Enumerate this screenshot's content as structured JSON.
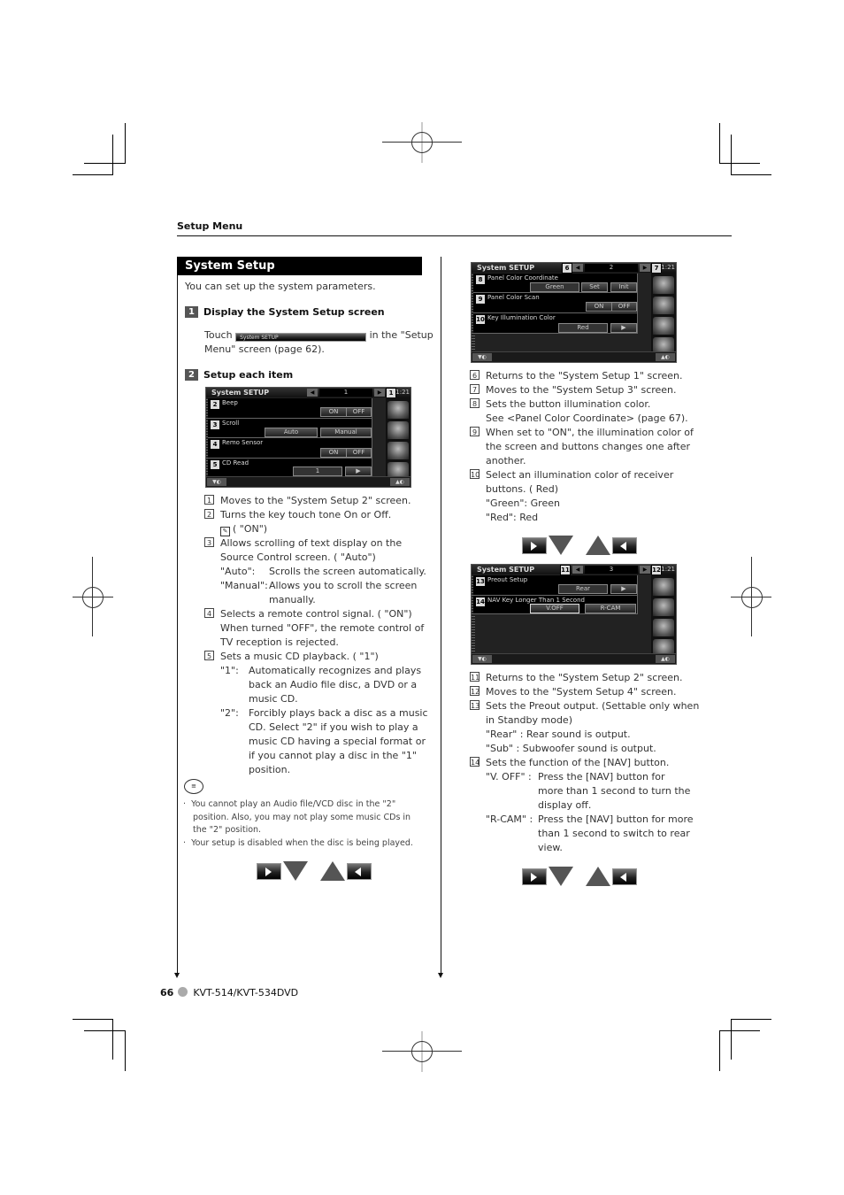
{
  "header": {
    "section": "Setup Menu"
  },
  "title": "System Setup",
  "intro": "You can set up the system parameters.",
  "steps": [
    {
      "num": "1",
      "title": "Display the System Setup screen",
      "text_before": "Touch",
      "button_label": "System SETUP",
      "text_after": "in the \"Setup",
      "text_line2": "Menu\" screen (page 62)."
    },
    {
      "num": "2",
      "title": "Setup each item"
    }
  ],
  "screens": [
    {
      "title": "System SETUP",
      "page": "1",
      "time": "1:21",
      "callouts": {
        "next": "1"
      },
      "rows": [
        {
          "num": "2",
          "label": "Beep",
          "buttons": [
            "ON",
            "OFF"
          ]
        },
        {
          "num": "3",
          "label": "Scroll",
          "buttons": [
            "Auto",
            "Manual"
          ]
        },
        {
          "num": "4",
          "label": "Remo Sensor",
          "buttons": [
            "ON",
            "OFF"
          ]
        },
        {
          "num": "5",
          "label": "CD Read",
          "value": "1",
          "arrow": "▶"
        }
      ]
    },
    {
      "title": "System SETUP",
      "page": "2",
      "time": "1:21",
      "callouts": {
        "prev": "6",
        "next": "7"
      },
      "rows": [
        {
          "num": "8",
          "label": "Panel Color Coordinate",
          "value": "Green",
          "buttons": [
            "Set",
            "Init"
          ]
        },
        {
          "num": "9",
          "label": "Panel Color Scan",
          "buttons": [
            "ON",
            "OFF"
          ]
        },
        {
          "num": "10",
          "label": "Key Illumination Color",
          "value": "Red",
          "arrow": "▶"
        }
      ]
    },
    {
      "title": "System SETUP",
      "page": "3",
      "time": "1:21",
      "callouts": {
        "prev": "11",
        "next": "12"
      },
      "rows": [
        {
          "num": "13",
          "label": "Preout Setup",
          "value": "Rear",
          "arrow": "▶"
        },
        {
          "num": "14",
          "label": "NAV Key Longer Than 1 Second",
          "buttons": [
            "V.OFF",
            "R-CAM"
          ]
        }
      ]
    }
  ],
  "left_list": [
    {
      "num": "1",
      "lines": [
        "Moves to the \"System Setup 2\" screen."
      ]
    },
    {
      "num": "2",
      "lines": [
        "Turns the key touch tone On or Off.",
        "( \"ON\")"
      ]
    },
    {
      "num": "3",
      "lines": [
        "Allows scrolling of text display on the",
        "Source Control screen. ( \"Auto\")"
      ],
      "defs": [
        {
          "term": "\"Auto\":",
          "lines": [
            "Scrolls the screen automatically."
          ]
        },
        {
          "term": "\"Manual\":",
          "lines": [
            "Allows you to scroll the screen",
            "manually."
          ]
        }
      ]
    },
    {
      "num": "4",
      "lines": [
        "Selects a remote control signal. ( \"ON\")",
        "When turned \"OFF\", the remote control of",
        "TV reception is rejected."
      ]
    },
    {
      "num": "5",
      "lines": [
        "Sets a music CD playback. ( \"1\")"
      ],
      "defs": [
        {
          "term": "\"1\":",
          "lines": [
            "Automatically recognizes and plays",
            "back an Audio file disc, a DVD or a",
            "music CD."
          ]
        },
        {
          "term": "\"2\":",
          "lines": [
            "Forcibly plays back a disc as a music",
            "CD. Select \"2\" if you wish to play a",
            "music CD having a special format or",
            "if you cannot play a disc in the \"1\"",
            "position."
          ]
        }
      ]
    }
  ],
  "notes": [
    "You cannot play an Audio file/VCD disc in the \"2\" position. Also, you may not play some music CDs in the \"2\" position.",
    "Your setup is disabled when the disc is being played."
  ],
  "right_list_a": [
    {
      "num": "6",
      "lines": [
        "Returns to the \"System Setup 1\" screen."
      ]
    },
    {
      "num": "7",
      "lines": [
        "Moves to the \"System Setup 3\" screen."
      ]
    },
    {
      "num": "8",
      "lines": [
        "Sets the button illumination color.",
        "See <Panel Color Coordinate> (page 67)."
      ]
    },
    {
      "num": "9",
      "lines": [
        "When set to \"ON\", the illumination color of",
        "the screen and buttons changes one after",
        "another."
      ]
    },
    {
      "num": "10",
      "lines": [
        "Select an illumination color of receiver",
        "buttons. ( Red)",
        "\"Green\": Green",
        "\"Red\": Red"
      ]
    }
  ],
  "right_list_b": [
    {
      "num": "11",
      "lines": [
        "Returns to the \"System Setup 2\" screen."
      ]
    },
    {
      "num": "12",
      "lines": [
        "Moves to the \"System Setup 4\" screen."
      ]
    },
    {
      "num": "13",
      "lines": [
        "Sets the Preout output. (Settable only when",
        "in Standby mode)",
        "\"Rear\" : Rear sound is output.",
        "\"Sub\" :  Subwoofer sound is output."
      ]
    },
    {
      "num": "14",
      "lines": [
        "Sets the function of the [NAV] button."
      ],
      "defs": [
        {
          "term": "\"V. OFF\" :",
          "lines": [
            "Press the [NAV] button for",
            "more than 1 second to turn the",
            "display off."
          ]
        },
        {
          "term": "\"R-CAM\" :",
          "lines": [
            "Press the [NAV] button for more",
            "than 1 second to switch to rear",
            "view."
          ]
        }
      ]
    }
  ],
  "footer": {
    "page": "66",
    "model": "KVT-514/KVT-534DVD"
  }
}
